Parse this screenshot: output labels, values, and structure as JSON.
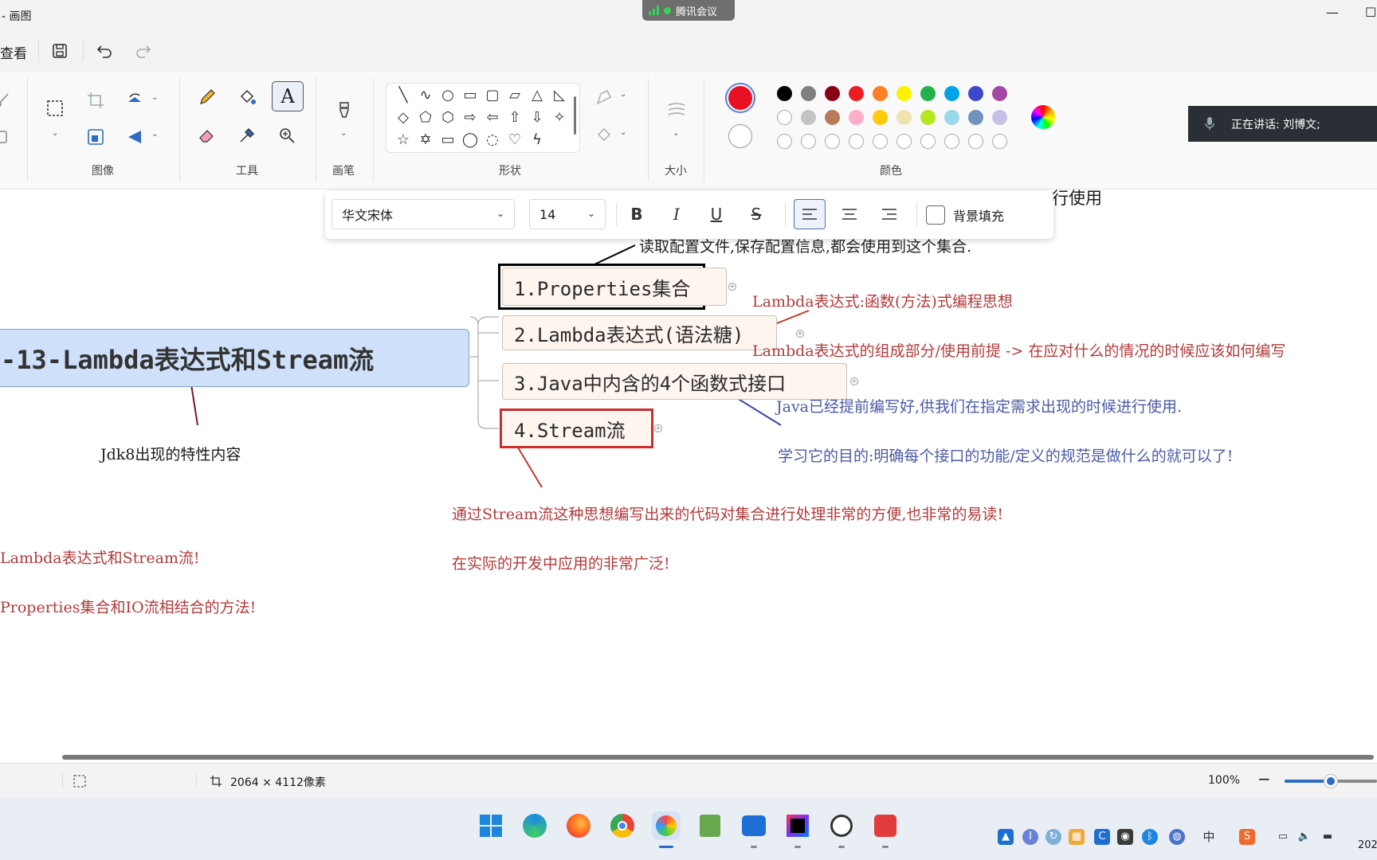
{
  "window": {
    "title": "- 画图",
    "meeting_badge": "腾讯会议",
    "controls": {
      "minimize": "—",
      "maximize": "☐"
    }
  },
  "quickbar": {
    "view_menu": "查看"
  },
  "ribbon": {
    "groups": {
      "image": "图像",
      "tools": "工具",
      "brushes": "画笔",
      "shapes": "形状",
      "size": "大小",
      "colors": "颜色"
    },
    "primary_color": "#e81123",
    "secondary_color": "#ffffff",
    "palette_row1": [
      "#000000",
      "#7f7f7f",
      "#880015",
      "#ed1c24",
      "#ff7f27",
      "#fff200",
      "#22b14c",
      "#00a2e8",
      "#3f48cc",
      "#a349a4"
    ],
    "palette_row2": [
      "#ffffff",
      "#c3c3c3",
      "#b97a57",
      "#ffaec9",
      "#ffc90e",
      "#efe4b0",
      "#b5e61d",
      "#99d9ea",
      "#7092be",
      "#c8bfe7"
    ]
  },
  "meeting": {
    "speaking": "正在讲话: 刘博文;"
  },
  "format_bar": {
    "font": "华文宋体",
    "size": "14",
    "bold": "B",
    "italic": "I",
    "underline": "U",
    "strike": "S",
    "bg_fill": "背景填充"
  },
  "canvas": {
    "partial_right": "行使用",
    "central_node": "-13-Lambda表达式和Stream流",
    "central_note": "Jdk8出现的特性内容",
    "node1": "1.Properties集合",
    "node2": "2.Lambda表达式(语法糖)",
    "node3": "3.Java中内含的4个函数式接口",
    "node4": "4.Stream流",
    "note_properties": "读取配置文件,保存配置信息,都会使用到这个集合.",
    "note_lambda1": "Lambda表达式:函数(方法)式编程思想",
    "note_lambda2": "Lambda表达式的组成部分/使用前提  -> 在应对什么的情况的时候应该如何编写",
    "note_java1": "Java已经提前编写好,供我们在指定需求出现的时候进行使用.",
    "note_java2": "学习它的目的:明确每个接口的功能/定义的规范是做什么的就可以了!",
    "note_stream1": "通过Stream流这种思想编写出来的代码对集合进行处理非常的方便,也非常的易读!",
    "note_stream2": "在实际的开发中应用的非常广泛!",
    "left_note1": "Lambda表达式和Stream流!",
    "left_note2": "Properties集合和IO流相结合的方法!"
  },
  "statusbar": {
    "dimensions": "2064 × 4112像素",
    "zoom": "100%",
    "zoom_level": 0.5
  },
  "taskbar": {
    "clock_partial": "202"
  }
}
